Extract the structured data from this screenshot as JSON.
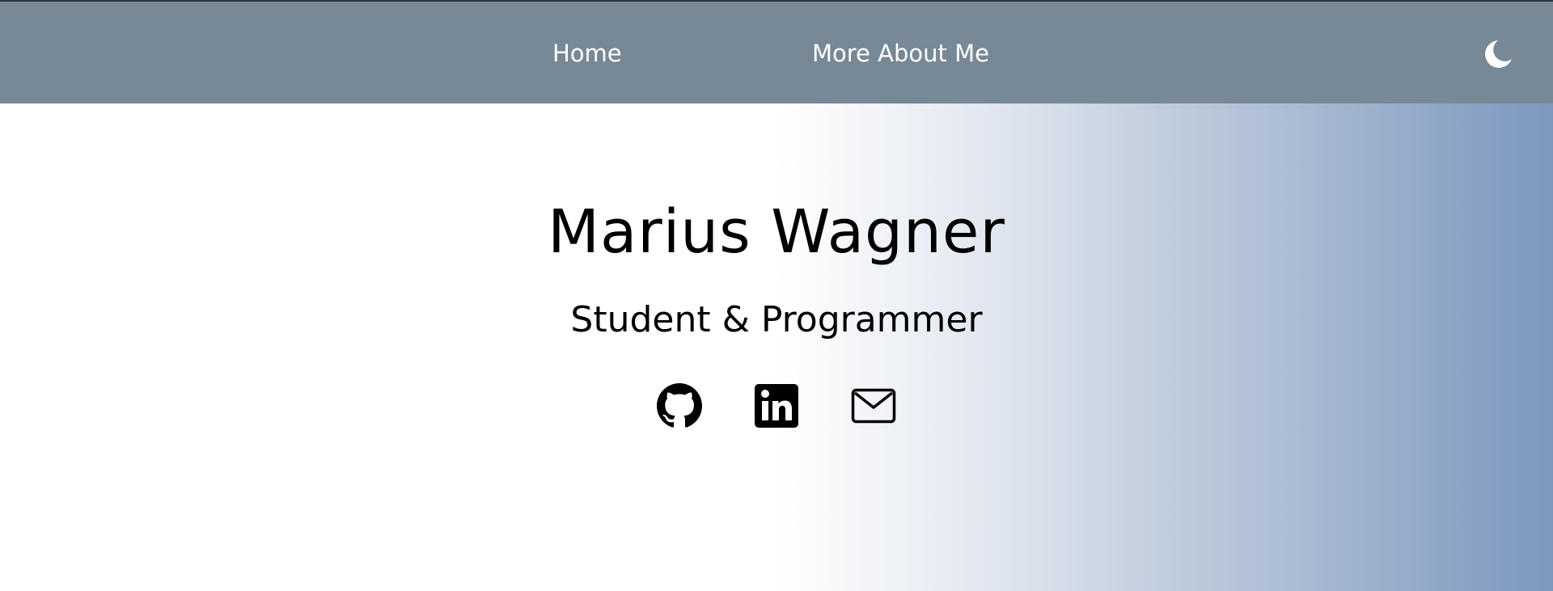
{
  "nav": {
    "home_label": "Home",
    "about_label": "More About Me",
    "theme_icon": "moon-icon"
  },
  "hero": {
    "name": "Marius Wagner",
    "subtitle": "Student & Programmer"
  },
  "social": [
    {
      "icon": "github-icon"
    },
    {
      "icon": "linkedin-icon"
    },
    {
      "icon": "mail-icon"
    }
  ],
  "colors": {
    "topbar": "#778896",
    "nav_text": "#ffffff",
    "gradient_end": "#7d98bf",
    "text": "#000000"
  }
}
